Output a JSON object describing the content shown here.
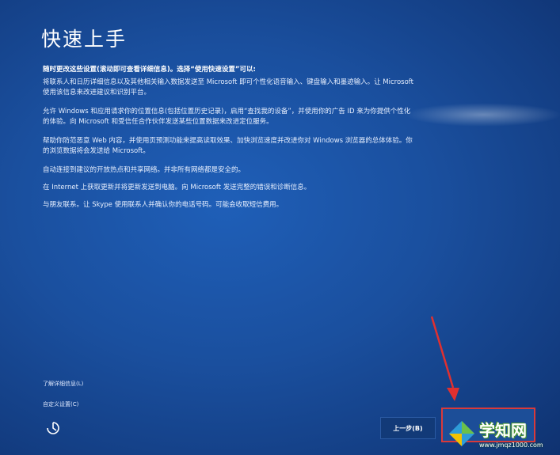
{
  "page": {
    "title": "快速上手",
    "intro": "随时更改这些设置(滚动即可查看详细信息)。选择“使用快速设置”可以:"
  },
  "settings": [
    "将联系人和日历详细信息以及其他相关输入数据发送至 Microsoft 即可个性化语音输入、键盘输入和墨迹输入。让 Microsoft 使用该信息来改进建议和识别平台。",
    "允许 Windows 和应用请求你的位置信息(包括位置历史记录)，启用“查找我的设备”，并使用你的广告 ID 来为你提供个性化的体验。向 Microsoft 和受信任合作伙伴发送某些位置数据来改进定位服务。",
    "帮助你防范恶意 Web 内容，并使用页预测功能来提高读取效果、加快浏览速度并改进你对 Windows 浏览器的总体体验。你的浏览数据将会发送给 Microsoft。",
    "自动连接到建议的开放热点和共享网络。并非所有网络都是安全的。",
    "在 Internet 上获取更新并将更新发送到电脑。向 Microsoft 发送完整的错误和诊断信息。",
    "与朋友联系。让 Skype 使用联系人并确认你的电话号码。可能会收取短信费用。"
  ],
  "links": {
    "learn_more": "了解详细信息(L)",
    "customize": "自定义设置(C)"
  },
  "buttons": {
    "back": "上一步(B)"
  },
  "watermark": {
    "name": "学知网",
    "url": "www.jmqz1000.com"
  },
  "colors": {
    "background": "#1a4f9e",
    "highlight_box": "#d93a3a",
    "annotation_arrow": "#e03030",
    "watermark_green": "#4c9a2a"
  },
  "icons": {
    "accessibility": "ease-of-access-icon",
    "watermark_logo": "diamond-logo-icon",
    "annotation": "red-arrow-icon"
  }
}
